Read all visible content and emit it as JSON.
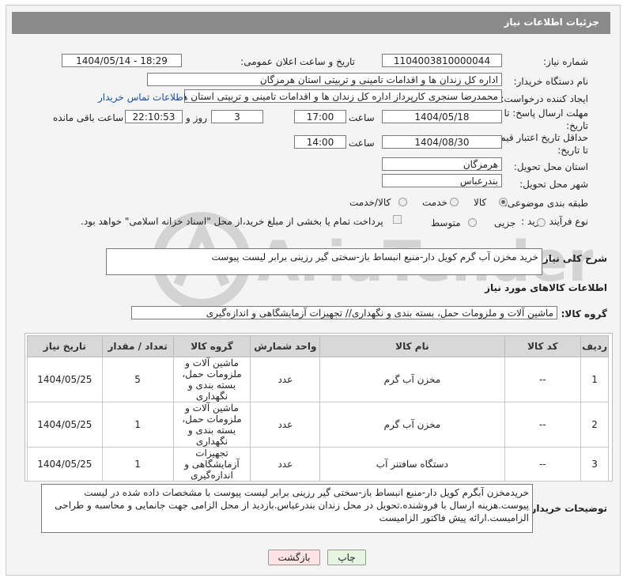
{
  "title": "جزئیات اطلاعات نیاز",
  "labels": {
    "need_number": "شماره نیاز:",
    "announce_datetime": "تاریخ و ساعت اعلان عمومی:",
    "buyer_org": "نام دستگاه خریدار:",
    "requester": "ایجاد کننده درخواست:",
    "reply_deadline": "مهلت ارسال پاسخ: تا تاریخ:",
    "price_validity": "حداقل تاریخ اعتبار قیمت: تا تاریخ:",
    "time": "ساعت",
    "time2": "ساعت",
    "days_and": "روز و",
    "remaining": "ساعت باقی مانده",
    "province": "استان محل تحویل:",
    "city": "شهر محل تحویل:",
    "category": "طبقه بندی موضوعی:",
    "process_type": "نوع فرآیند خرید :",
    "general_desc": "شرح کلی نیاز:",
    "goods_info": "اطلاعات کالاهای مورد نیاز",
    "goods_group": "گروه کالا:",
    "buyer_notes": "توضیحات خریدار:"
  },
  "values": {
    "need_number": "1104003810000044",
    "announce_datetime": "1404/05/14 - 18:29",
    "buyer_org": "اداره کل زندان ها و اقدامات تامینی و تربیتی استان هرمزگان",
    "requester": "محمدرضا سنجری کارپرداز اداره کل زندان ها و اقدامات تامینی و تربیتی استان هر",
    "contact_link": "اطلاعات تماس خریدار",
    "reply_date": "1404/05/18",
    "reply_time": "17:00",
    "reply_days": "3",
    "reply_remaining": "22:10:53",
    "validity_date": "1404/08/30",
    "validity_time": "14:00",
    "province": "هرمزگان",
    "city": "بندرعباس",
    "general_desc": "خرید مخزن آب گرم کویل دار-منبع انبساط باز-سختی گیر رزینی برابر لیست پیوست",
    "goods_group": "ماشین آلات و ملزومات حمل، بسته بندی و نگهداری// تجهیزات آزمایشگاهی و اندازه‌گیری",
    "buyer_notes": "خریدمخزن آبگرم کویل دار-منبع انبساط باز-سختی گیر رزینی برابر لیست پیوست با مشخصات داده شده در لیست پیوست.هزینه ارسال با فروشنده.تحویل در محل زندان بندرعباس.بازدید از محل الزامی جهت جانمایی و محاسبه و طراحی الزامیست.ارائه پیش فاکتور الزامیست"
  },
  "category_options": [
    {
      "label": "کالا",
      "selected": true
    },
    {
      "label": "خدمت",
      "selected": false
    },
    {
      "label": "کالا/خدمت",
      "selected": false
    }
  ],
  "process_options": [
    {
      "label": "جزیی",
      "selected": false
    },
    {
      "label": "متوسط",
      "selected": false
    }
  ],
  "payment_note": "پرداخت تمام یا بخشی از مبلغ خرید،از محل \"اسناد خزانه اسلامی\" خواهد بود.",
  "table": {
    "headers": [
      "ردیف",
      "کد کالا",
      "نام کالا",
      "واحد شمارش",
      "گروه کالا",
      "تعداد / مقدار",
      "تاریخ نیاز"
    ],
    "rows": [
      {
        "index": "1",
        "code": "--",
        "name": "مخزن آب گرم",
        "unit": "عدد",
        "group": "ماشین آلات و ملزومات حمل، بسته بندی و نگهداری",
        "qty": "5",
        "date": "1404/05/25"
      },
      {
        "index": "2",
        "code": "--",
        "name": "مخزن آب گرم",
        "unit": "عدد",
        "group": "ماشین آلات و ملزومات حمل، بسته بندی و نگهداری",
        "qty": "1",
        "date": "1404/05/25"
      },
      {
        "index": "3",
        "code": "--",
        "name": "دستگاه سافتنر آب",
        "unit": "عدد",
        "group": "تجهیزات آزمایشگاهی و اندازه‌گیری",
        "qty": "1",
        "date": "1404/05/25"
      }
    ]
  },
  "buttons": {
    "print": "چاپ",
    "back": "بازگشت"
  },
  "watermark": "AriaTender.net",
  "colors": {
    "titlebar": "#8a8a8a",
    "link": "#1a4fa0",
    "print_btn": "#e6f5e0",
    "back_btn": "#fde3e3"
  }
}
